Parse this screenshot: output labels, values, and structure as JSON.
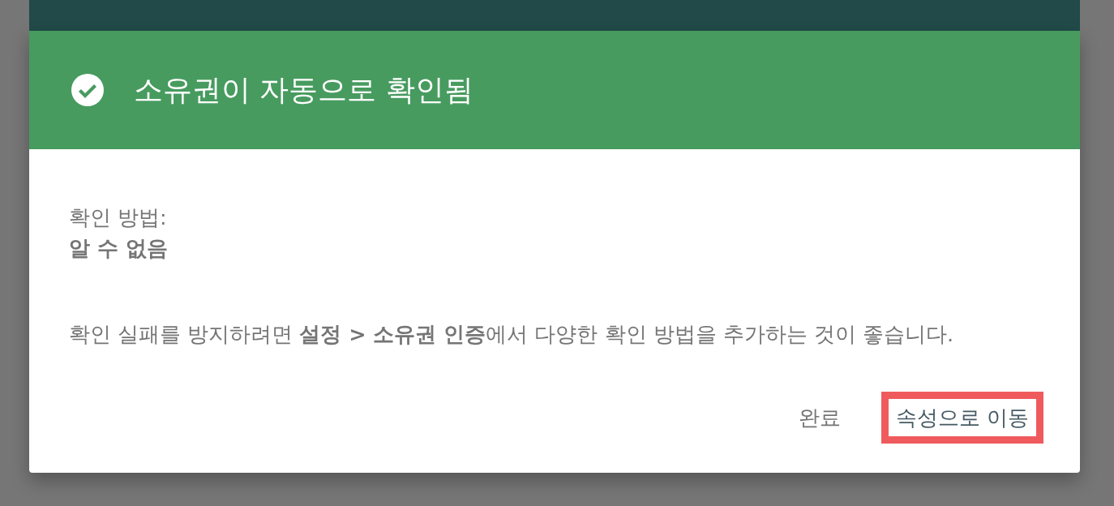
{
  "dialog": {
    "verified": true,
    "title": "소유권이 자동으로 확인됨",
    "method_label": "확인 방법:",
    "method_value": "알 수 없음",
    "note": "확인 실패를 방지하려면 **설정 > 소유권 인증**에서 다양한 확인 방법을 추가하는 것이 좋습니다.",
    "actions": [
      {
        "label": "완료",
        "kind": "secondary",
        "highlighted": false
      },
      {
        "label": "속성으로 이동",
        "kind": "primary",
        "highlighted": true
      }
    ]
  }
}
